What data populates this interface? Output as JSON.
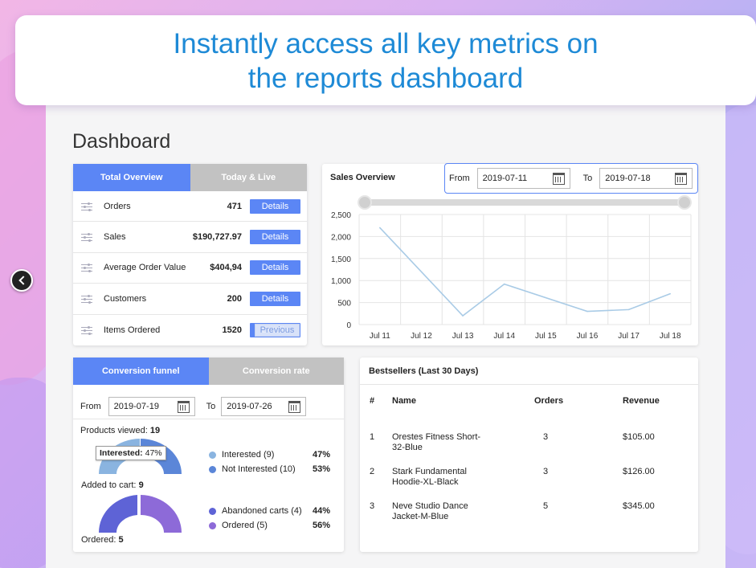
{
  "headline": {
    "line1": "Instantly access all key metrics on",
    "line2": "the reports dashboard"
  },
  "page_title": "Dashboard",
  "overview": {
    "tabs": [
      "Total Overview",
      "Today & Live"
    ],
    "rows": [
      {
        "label": "Orders",
        "value": "471",
        "button": "Details"
      },
      {
        "label": "Sales",
        "value": "$190,727.97",
        "button": "Details"
      },
      {
        "label": "Average Order Value",
        "value": "$404,94",
        "button": "Details"
      },
      {
        "label": "Customers",
        "value": "200",
        "button": "Details"
      },
      {
        "label": "Items Ordered",
        "value": "1520",
        "button": "Details"
      }
    ],
    "tooltip": "Previous"
  },
  "sales_overview": {
    "title": "Sales Overview",
    "from_label": "From",
    "from_value": "2019-07-11",
    "to_label": "To",
    "to_value": "2019-07-18"
  },
  "chart_data": {
    "type": "line",
    "x": [
      "Jul 11",
      "Jul 12",
      "Jul 13",
      "Jul 14",
      "Jul 15",
      "Jul 16",
      "Jul 17",
      "Jul 18"
    ],
    "series": [
      {
        "values": [
          2200,
          null,
          200,
          920,
          null,
          300,
          340,
          700
        ]
      }
    ],
    "points": [
      {
        "x": "Jul 11",
        "y": 2200
      },
      {
        "x": "Jul 13",
        "y": 200
      },
      {
        "x": "Jul 14",
        "y": 920
      },
      {
        "x": "Jul 16",
        "y": 300
      },
      {
        "x": "Jul 17",
        "y": 340
      },
      {
        "x": "Jul 18",
        "y": 700
      }
    ],
    "yticks": [
      "0",
      "500",
      "1,000",
      "1,500",
      "2,000",
      "2,500"
    ],
    "ylim": [
      0,
      2500
    ],
    "grid": true,
    "line_color": "#a9cbe6"
  },
  "funnel": {
    "tabs": [
      "Conversion funnel",
      "Conversion rate"
    ],
    "from_label": "From",
    "from_value": "2019-07-19",
    "to_label": "To",
    "to_value": "2019-07-26",
    "viewed_label": "Products viewed:",
    "viewed_value": "19",
    "tooltip_label": "Interested:",
    "tooltip_value": "47%",
    "cart_label": "Added to cart:",
    "cart_value": "9",
    "ordered_label": "Ordered:",
    "ordered_value": "5",
    "legend1": [
      {
        "label": "Interested (9)",
        "pct": "47%",
        "color": "#8ab4e0"
      },
      {
        "label": "Not Interested (10)",
        "pct": "53%",
        "color": "#5b86d8"
      }
    ],
    "legend2": [
      {
        "label": "Abandoned carts (4)",
        "pct": "44%",
        "color": "#5e63d6"
      },
      {
        "label": "Ordered (5)",
        "pct": "56%",
        "color": "#8d6ad8"
      }
    ]
  },
  "bestsellers": {
    "title": "Bestsellers (Last 30 Days)",
    "headers": [
      "#",
      "Name",
      "Orders",
      "Revenue"
    ],
    "rows": [
      {
        "num": "1",
        "name1": "Orestes Fitness Short-",
        "name2": "32-Blue",
        "orders": "3",
        "revenue": "$105.00"
      },
      {
        "num": "2",
        "name1": "Stark Fundamental",
        "name2": "Hoodie-XL-Black",
        "orders": "3",
        "revenue": "$126.00"
      },
      {
        "num": "3",
        "name1": "Neve Studio Dance",
        "name2": "Jacket-M-Blue",
        "orders": "5",
        "revenue": "$345.00"
      }
    ]
  }
}
